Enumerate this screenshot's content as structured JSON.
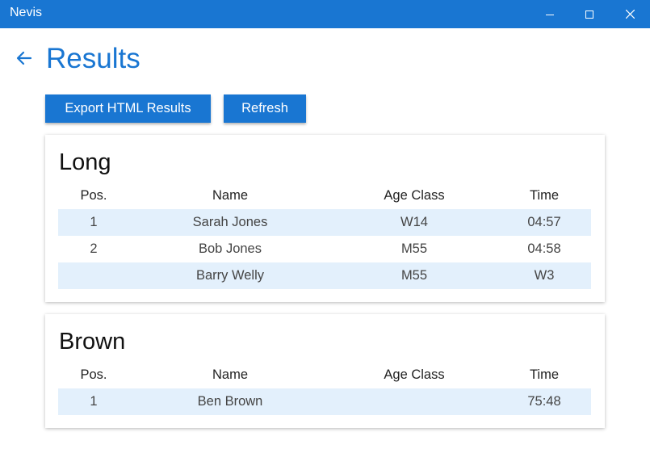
{
  "window": {
    "title": "Nevis"
  },
  "page": {
    "title": "Results"
  },
  "buttons": {
    "export_label": "Export HTML Results",
    "refresh_label": "Refresh"
  },
  "columns": {
    "pos": "Pos.",
    "name": "Name",
    "age_class": "Age Class",
    "time": "Time"
  },
  "courses": [
    {
      "name": "Long",
      "rows": [
        {
          "pos": "1",
          "name": "Sarah Jones",
          "age_class": "W14",
          "time": "04:57"
        },
        {
          "pos": "2",
          "name": "Bob Jones",
          "age_class": "M55",
          "time": "04:58"
        },
        {
          "pos": "",
          "name": "Barry Welly",
          "age_class": "M55",
          "time": "W3"
        }
      ]
    },
    {
      "name": "Brown",
      "rows": [
        {
          "pos": "1",
          "name": "Ben Brown",
          "age_class": "",
          "time": "75:48"
        }
      ]
    }
  ],
  "colors": {
    "accent": "#1976d2",
    "row_shade": "#e3f0fc"
  }
}
